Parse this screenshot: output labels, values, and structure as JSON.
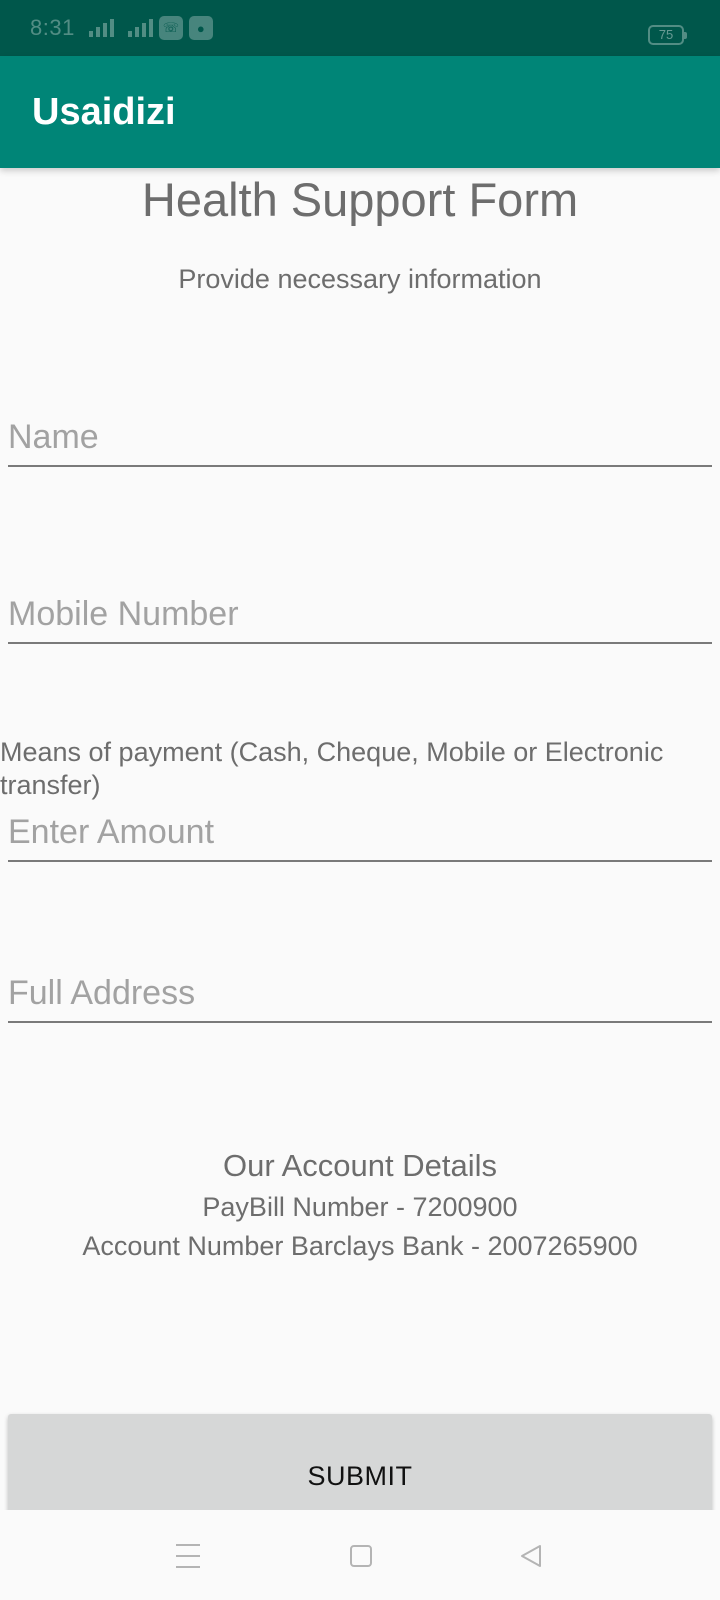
{
  "status_bar": {
    "time": "8:31",
    "battery": "75",
    "icons": [
      "signal-icon",
      "signal-icon",
      "whatsapp-icon",
      "app-icon"
    ]
  },
  "app_bar": {
    "title": "Usaidizi",
    "color": "#008577"
  },
  "form": {
    "title": "Health Support Form",
    "subtitle": "Provide necessary information",
    "name_placeholder": "Name",
    "mobile_placeholder": "Mobile Number",
    "payment_note": "Means of payment (Cash, Cheque, Mobile or Electronic transfer)",
    "amount_placeholder": "Enter Amount",
    "address_placeholder": "Full Address"
  },
  "account": {
    "heading": "Our Account Details",
    "paybill": "PayBill Number - 7200900",
    "bank_account": "Account Number Barclays Bank - 2007265900"
  },
  "submit_label": "SUBMIT",
  "nav": {
    "icons": [
      "menu-icon",
      "home-icon",
      "back-icon"
    ]
  }
}
